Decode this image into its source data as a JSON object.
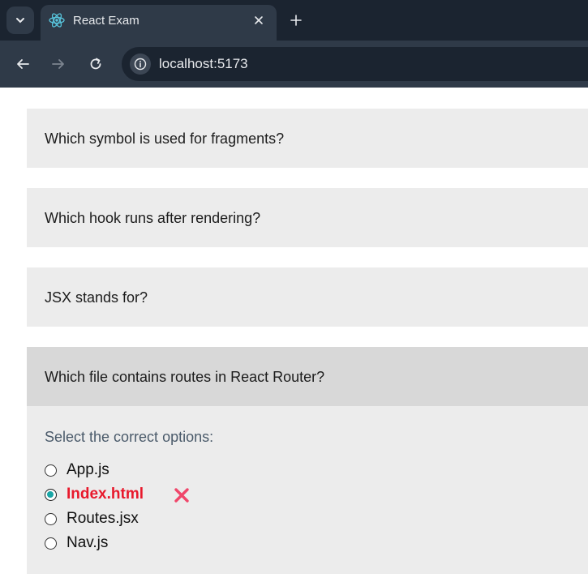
{
  "browser": {
    "tab_title": "React Exam",
    "url": "localhost:5173"
  },
  "questions": [
    {
      "text": "Which symbol is used for fragments?"
    },
    {
      "text": "Which hook runs after rendering?"
    },
    {
      "text": "JSX stands for?"
    },
    {
      "text": "Which file contains routes in React Router?",
      "prompt": "Select the correct options:",
      "options": [
        {
          "label": "App.js",
          "selected": false
        },
        {
          "label": "Index.html",
          "selected": true,
          "result": "incorrect"
        },
        {
          "label": "Routes.jsx",
          "selected": false
        },
        {
          "label": "Nav.js",
          "selected": false
        }
      ]
    }
  ],
  "colors": {
    "incorrect": "#e8192c",
    "radio_selected": "#1aa6a6",
    "panel_bg": "#ececec",
    "active_header_bg": "#d8d8d8"
  },
  "icons": {
    "tab": "react-logo-icon",
    "wrong": "cross-mark-icon"
  }
}
